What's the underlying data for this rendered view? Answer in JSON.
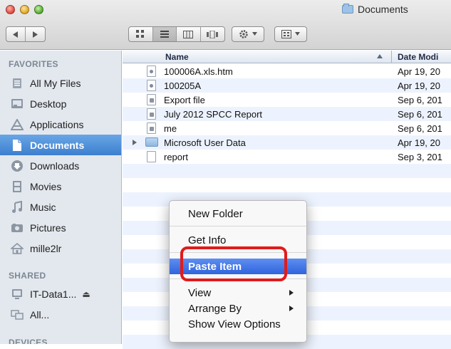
{
  "window": {
    "title": "Documents"
  },
  "toolbar": {
    "back_icon": "chevron-left-icon",
    "forward_icon": "chevron-right-icon",
    "views": [
      "icon-view-icon",
      "list-view-icon",
      "column-view-icon",
      "cover-flow-icon"
    ],
    "action_icon": "gear-icon",
    "arrange_icon": "arrange-grid-icon"
  },
  "sidebar": {
    "favorites_header": "FAVORITES",
    "favorites": [
      {
        "label": "All My Files",
        "icon": "all-files-icon"
      },
      {
        "label": "Desktop",
        "icon": "desktop-icon"
      },
      {
        "label": "Applications",
        "icon": "applications-icon"
      },
      {
        "label": "Documents",
        "icon": "documents-icon",
        "selected": true
      },
      {
        "label": "Downloads",
        "icon": "downloads-icon"
      },
      {
        "label": "Movies",
        "icon": "movies-icon"
      },
      {
        "label": "Music",
        "icon": "music-icon"
      },
      {
        "label": "Pictures",
        "icon": "pictures-icon"
      },
      {
        "label": "mille2lr",
        "icon": "home-icon"
      }
    ],
    "shared_header": "SHARED",
    "shared": [
      {
        "label": "IT-Data1...",
        "icon": "server-icon",
        "eject": "⏏"
      },
      {
        "label": "All...",
        "icon": "network-icon"
      }
    ],
    "devices_header": "DEVICES"
  },
  "file_list": {
    "columns": {
      "name": "Name",
      "date": "Date Modi"
    },
    "rows": [
      {
        "name": "100006A.xls.htm",
        "date": "Apr 19, 20",
        "kind": "web"
      },
      {
        "name": "100205A",
        "date": "Apr 19, 20",
        "kind": "web"
      },
      {
        "name": "Export file",
        "date": "Sep 6, 201",
        "kind": "doc"
      },
      {
        "name": "July 2012 SPCC Report",
        "date": "Sep 6, 201",
        "kind": "doc"
      },
      {
        "name": "me",
        "date": "Sep 6, 201",
        "kind": "doc"
      },
      {
        "name": "Microsoft User Data",
        "date": "Apr 19, 20",
        "kind": "folder"
      },
      {
        "name": "report",
        "date": "Sep 3, 201",
        "kind": "plain"
      }
    ]
  },
  "context_menu": {
    "new_folder": "New Folder",
    "get_info": "Get Info",
    "paste_item": "Paste Item",
    "view": "View",
    "arrange_by": "Arrange By",
    "show_view_options": "Show View Options"
  },
  "colors": {
    "sidebar_bg": "#e3e8ee",
    "selection_blue": "#3c7fcf",
    "menu_highlight": "#2f64de",
    "callout_red": "#e11b1b"
  }
}
